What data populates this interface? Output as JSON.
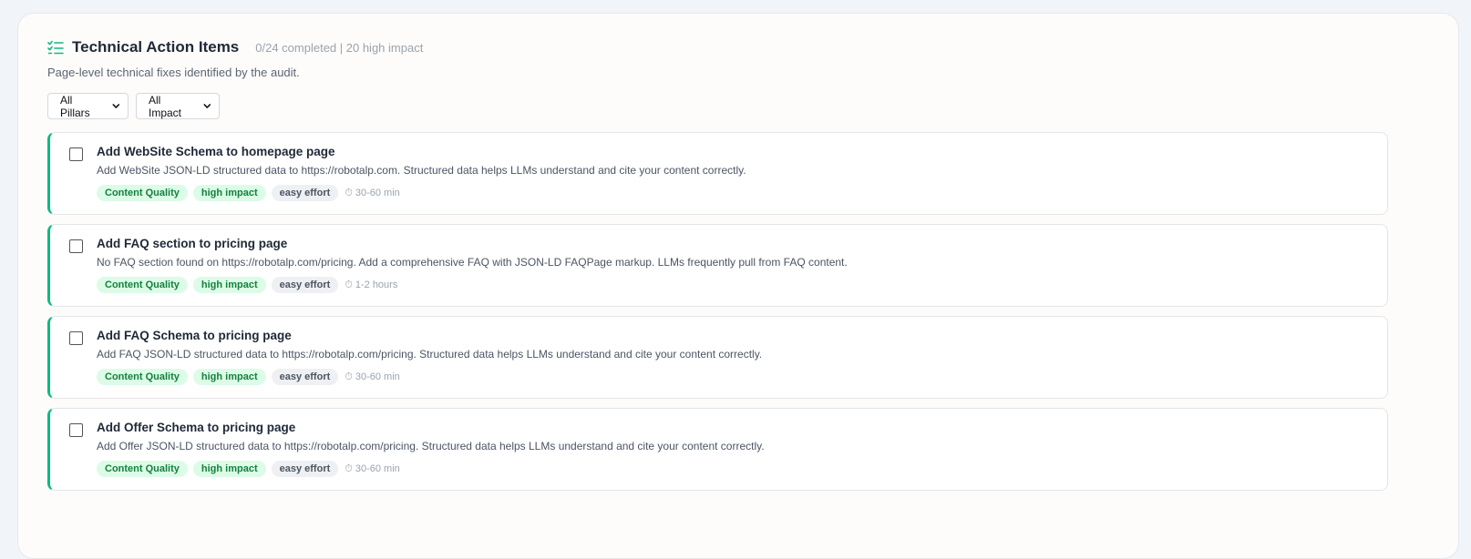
{
  "panel": {
    "title": "Technical Action Items",
    "meta": "0/24 completed | 20 high impact",
    "subtitle": "Page-level technical fixes identified by the audit."
  },
  "filters": {
    "pillars": "All Pillars",
    "impact": "All Impact"
  },
  "colors": {
    "accent": "#10b981",
    "tag_green_bg": "#dcfce7",
    "tag_green_text": "#15803d"
  },
  "items": [
    {
      "title": "Add WebSite Schema to homepage page",
      "description": "Add WebSite JSON-LD structured data to https://robotalp.com. Structured data helps LLMs understand and cite your content correctly.",
      "pillar": "Content Quality",
      "impact": "high impact",
      "effort": "easy effort",
      "time": "30-60 min"
    },
    {
      "title": "Add FAQ section to pricing page",
      "description": "No FAQ section found on https://robotalp.com/pricing. Add a comprehensive FAQ with JSON-LD FAQPage markup. LLMs frequently pull from FAQ content.",
      "pillar": "Content Quality",
      "impact": "high impact",
      "effort": "easy effort",
      "time": "1-2 hours"
    },
    {
      "title": "Add FAQ Schema to pricing page",
      "description": "Add FAQ JSON-LD structured data to https://robotalp.com/pricing. Structured data helps LLMs understand and cite your content correctly.",
      "pillar": "Content Quality",
      "impact": "high impact",
      "effort": "easy effort",
      "time": "30-60 min"
    },
    {
      "title": "Add Offer Schema to pricing page",
      "description": "Add Offer JSON-LD structured data to https://robotalp.com/pricing. Structured data helps LLMs understand and cite your content correctly.",
      "pillar": "Content Quality",
      "impact": "high impact",
      "effort": "easy effort",
      "time": "30-60 min"
    }
  ]
}
